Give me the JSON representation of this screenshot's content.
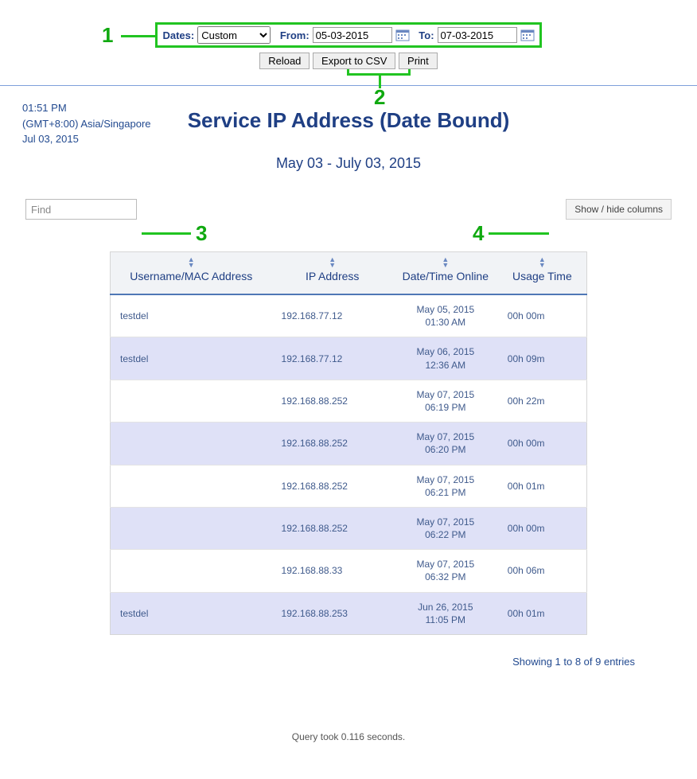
{
  "callouts": {
    "n1": "1",
    "n2": "2",
    "n3": "3",
    "n4": "4"
  },
  "filters": {
    "dates_label": "Dates:",
    "dates_value": "Custom",
    "from_label": "From:",
    "from_value": "05-03-2015",
    "to_label": "To:",
    "to_value": "07-03-2015"
  },
  "buttons": {
    "reload": "Reload",
    "export_csv": "Export to CSV",
    "print": "Print",
    "show_hide": "Show / hide columns"
  },
  "meta": {
    "time": "01:51 PM",
    "tz": "(GMT+8:00) Asia/Singapore",
    "date": "Jul 03, 2015"
  },
  "title": "Service IP Address (Date Bound)",
  "subtitle": "May 03 - July 03, 2015",
  "find_placeholder": "Find",
  "columns": {
    "user": "Username/MAC Address",
    "ip": "IP Address",
    "dt": "Date/Time Online",
    "usage": "Usage Time"
  },
  "rows": [
    {
      "user": "testdel",
      "ip": "192.168.77.12",
      "date": "May 05, 2015",
      "time": "01:30 AM",
      "usage": "00h 00m"
    },
    {
      "user": "testdel",
      "ip": "192.168.77.12",
      "date": "May 06, 2015",
      "time": "12:36 AM",
      "usage": "00h 09m"
    },
    {
      "user": "",
      "ip": "192.168.88.252",
      "date": "May 07, 2015",
      "time": "06:19 PM",
      "usage": "00h 22m"
    },
    {
      "user": "",
      "ip": "192.168.88.252",
      "date": "May 07, 2015",
      "time": "06:20 PM",
      "usage": "00h 00m"
    },
    {
      "user": "",
      "ip": "192.168.88.252",
      "date": "May 07, 2015",
      "time": "06:21 PM",
      "usage": "00h 01m"
    },
    {
      "user": "",
      "ip": "192.168.88.252",
      "date": "May 07, 2015",
      "time": "06:22 PM",
      "usage": "00h 00m"
    },
    {
      "user": "",
      "ip": "192.168.88.33",
      "date": "May 07, 2015",
      "time": "06:32 PM",
      "usage": "00h 06m"
    },
    {
      "user": "testdel",
      "ip": "192.168.88.253",
      "date": "Jun 26, 2015",
      "time": "11:05 PM",
      "usage": "00h 01m"
    }
  ],
  "entries_info": "Showing 1 to 8 of 9 entries",
  "query_time": "Query took 0.116 seconds."
}
